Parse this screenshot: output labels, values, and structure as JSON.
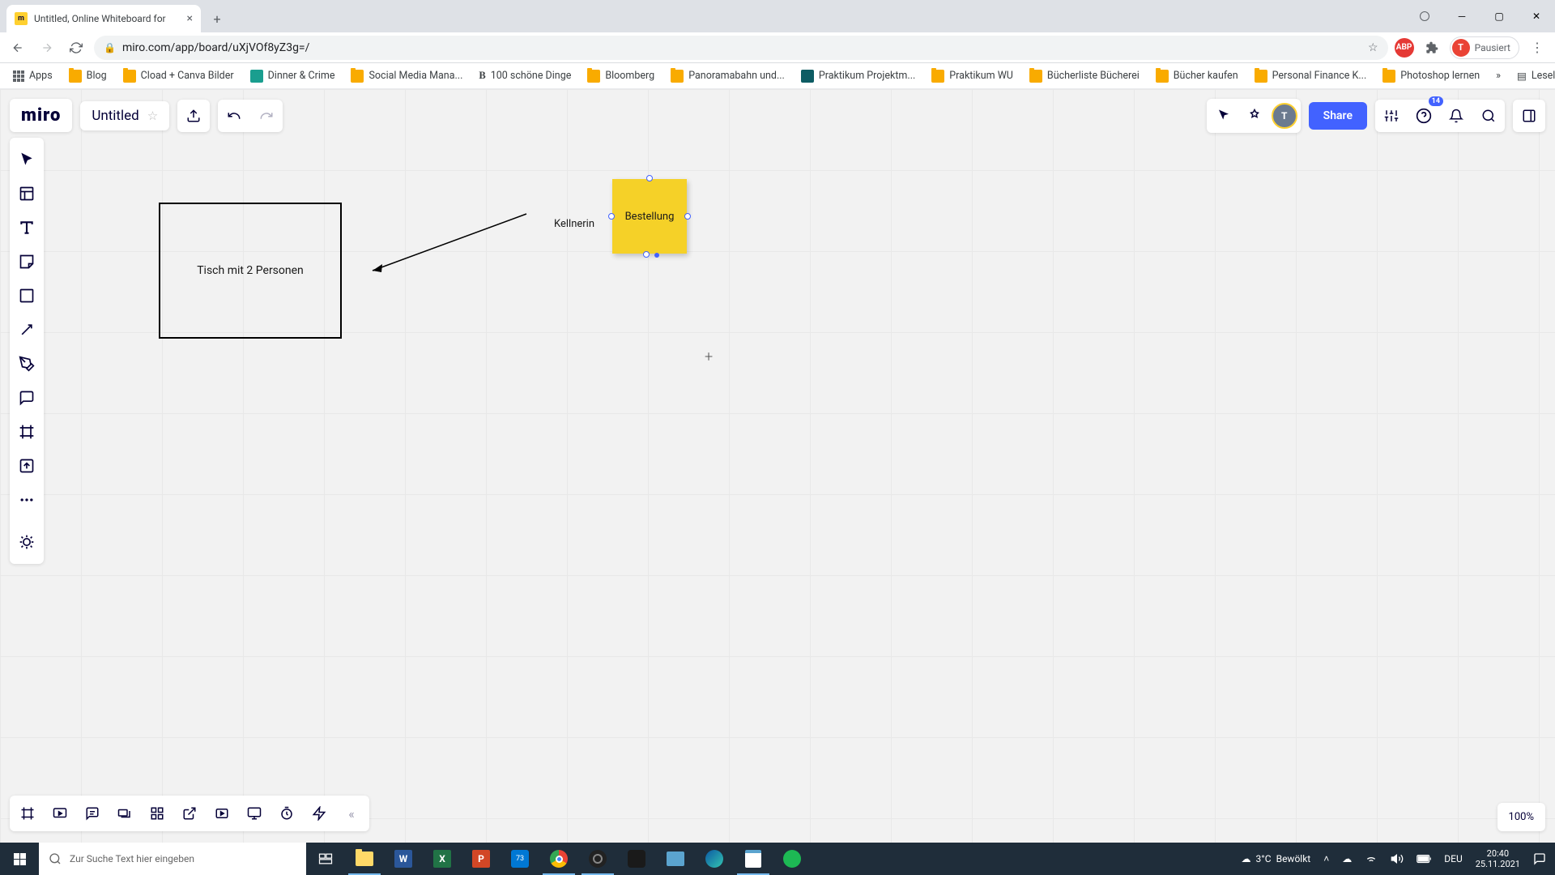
{
  "browser": {
    "tab_title": "Untitled, Online Whiteboard for",
    "url": "miro.com/app/board/uXjVOf8yZ3g=/",
    "profile_label": "Pausiert",
    "profile_initial": "T",
    "bookmarks": [
      {
        "label": "Apps",
        "type": "grid"
      },
      {
        "label": "Blog",
        "type": "folder"
      },
      {
        "label": "Cload + Canva Bilder",
        "type": "folder"
      },
      {
        "label": "Dinner & Crime",
        "type": "icon",
        "color": "#1a9e8f"
      },
      {
        "label": "Social Media Mana...",
        "type": "folder"
      },
      {
        "label": "100 schöne Dinge",
        "type": "text",
        "prefix": "B"
      },
      {
        "label": "Bloomberg",
        "type": "folder"
      },
      {
        "label": "Panoramabahn und...",
        "type": "folder"
      },
      {
        "label": "Praktikum Projektm...",
        "type": "icon",
        "color": "#0d5c63"
      },
      {
        "label": "Praktikum WU",
        "type": "folder"
      },
      {
        "label": "Bücherliste Bücherei",
        "type": "folder"
      },
      {
        "label": "Bücher kaufen",
        "type": "folder"
      },
      {
        "label": "Personal Finance K...",
        "type": "folder"
      },
      {
        "label": "Photoshop lernen",
        "type": "folder"
      }
    ],
    "overflow": "»",
    "reading_list": "Leseliste"
  },
  "miro": {
    "logo": "miro",
    "board_name": "Untitled",
    "share": "Share",
    "notif_count": "14",
    "avatar_initial": "T",
    "zoom": "100%"
  },
  "canvas": {
    "rect_label": "Tisch mit 2 Personen",
    "line_label": "Kellnerin",
    "sticky_label": "Bestellung"
  },
  "taskbar": {
    "search_placeholder": "Zur Suche Text hier eingeben",
    "weather_temp": "3°C",
    "weather_text": "Bewölkt",
    "lang": "DEU",
    "time": "20:40",
    "date": "25.11.2021"
  }
}
